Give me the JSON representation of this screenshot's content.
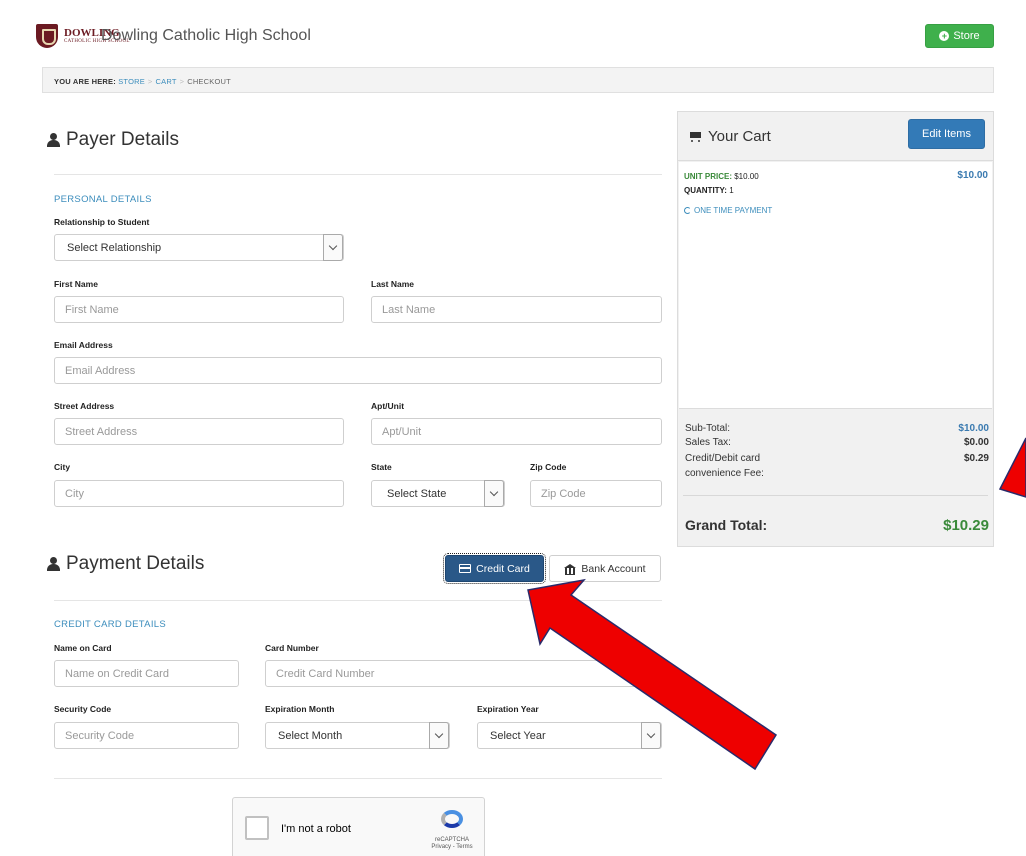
{
  "header": {
    "logo_word": "DOWLING",
    "logo_sub": "CATHOLIC HIGH SCHOOL",
    "school_name": "Dowling Catholic High School",
    "store_label": "Store"
  },
  "breadcrumb": {
    "prefix": "YOU ARE HERE:",
    "items": [
      "STORE",
      "CART",
      "CHECKOUT"
    ]
  },
  "payer": {
    "title": "Payer Details",
    "personal_heading": "PERSONAL DETAILS",
    "relationship_label": "Relationship to Student",
    "relationship_value": "Select Relationship",
    "first_name_label": "First Name",
    "first_name_placeholder": "First Name",
    "last_name_label": "Last Name",
    "last_name_placeholder": "Last Name",
    "email_label": "Email Address",
    "email_placeholder": "Email Address",
    "street_label": "Street Address",
    "street_placeholder": "Street Address",
    "apt_label": "Apt/Unit",
    "apt_placeholder": "Apt/Unit",
    "city_label": "City",
    "city_placeholder": "City",
    "state_label": "State",
    "state_value": "Select State",
    "zip_label": "Zip Code",
    "zip_placeholder": "Zip Code"
  },
  "payment": {
    "title": "Payment Details",
    "credit_card_label": "Credit Card",
    "bank_account_label": "Bank Account",
    "cc_heading": "CREDIT CARD DETAILS",
    "name_label": "Name on Card",
    "name_placeholder": "Name on Credit Card",
    "number_label": "Card Number",
    "number_placeholder": "Credit Card Number",
    "security_label": "Security Code",
    "security_placeholder": "Security Code",
    "month_label": "Expiration Month",
    "month_value": "Select Month",
    "year_label": "Expiration Year",
    "year_value": "Select Year"
  },
  "recaptcha": {
    "label": "I'm not a robot",
    "brand": "reCAPTCHA",
    "links": "Privacy - Terms"
  },
  "cart": {
    "title": "Your Cart",
    "edit_label": "Edit Items",
    "unit_price_label": "UNIT PRICE:",
    "unit_price_value": "$10.00",
    "quantity_label": "QUANTITY:",
    "quantity_value": "1",
    "payment_type": "ONE TIME PAYMENT",
    "item_total": "$10.00",
    "subtotal_label": "Sub-Total:",
    "subtotal_value": "$10.00",
    "tax_label": "Sales Tax:",
    "tax_value": "$0.00",
    "fee_label_1": "Credit/Debit card",
    "fee_label_2": "convenience Fee:",
    "fee_value": "$0.29",
    "grand_label": "Grand Total:",
    "grand_value": "$10.29"
  },
  "colors": {
    "annotation_arrow": "#ee0000",
    "link_blue": "#3c8dbc",
    "store_green": "#3fb04c",
    "total_green": "#3a8a3a"
  }
}
